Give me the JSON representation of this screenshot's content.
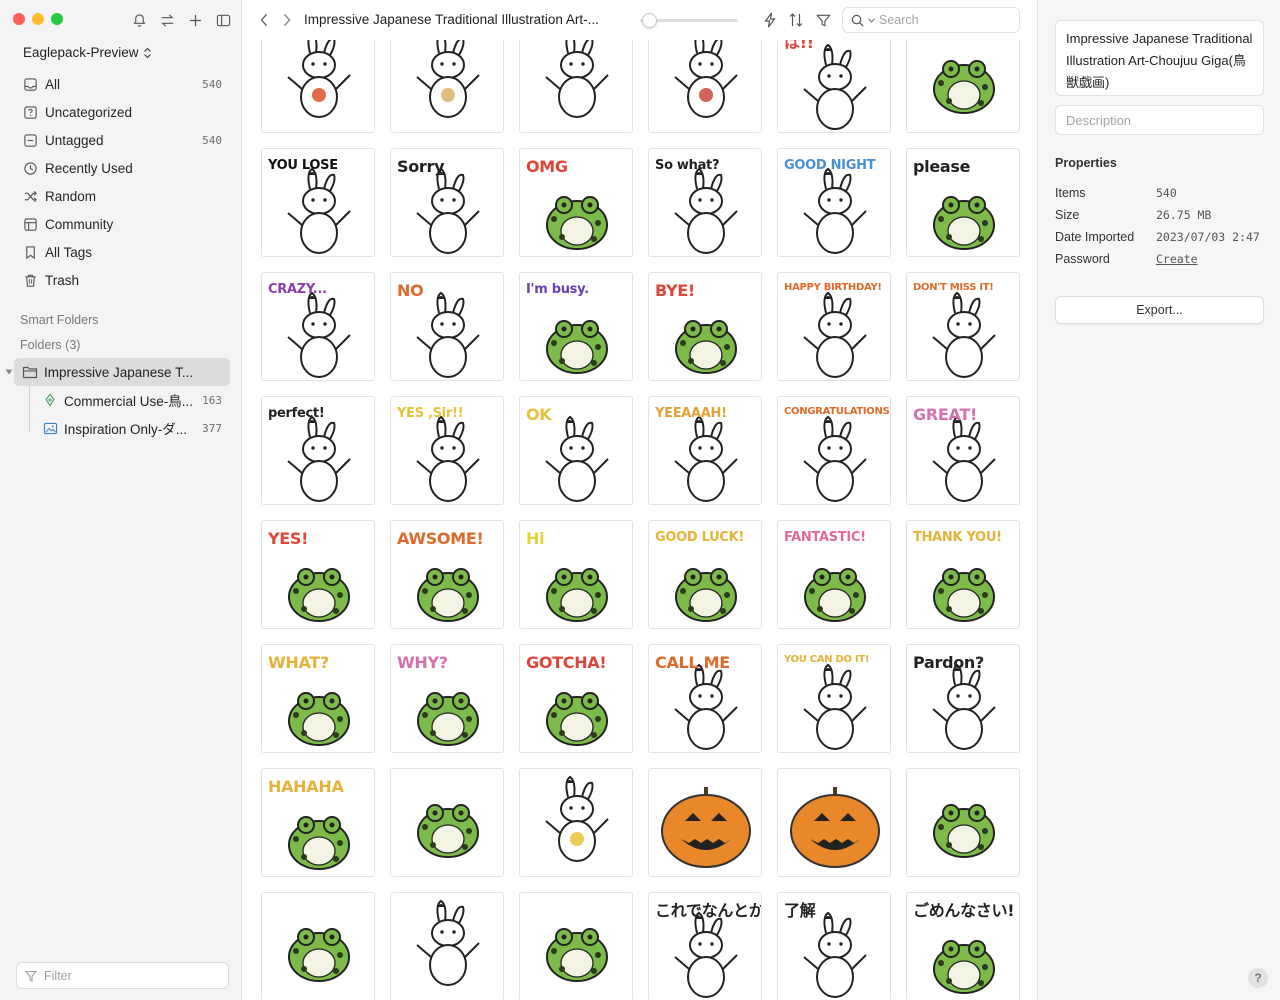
{
  "sidebar": {
    "library_name": "Eaglepack-Preview",
    "items": [
      {
        "label": "All",
        "count": "540",
        "icon": "inbox-icon"
      },
      {
        "label": "Uncategorized",
        "count": "",
        "icon": "question-box-icon"
      },
      {
        "label": "Untagged",
        "count": "540",
        "icon": "untagged-icon"
      },
      {
        "label": "Recently Used",
        "count": "",
        "icon": "clock-icon"
      },
      {
        "label": "Random",
        "count": "",
        "icon": "shuffle-icon"
      },
      {
        "label": "Community",
        "count": "",
        "icon": "community-icon"
      },
      {
        "label": "All Tags",
        "count": "",
        "icon": "bookmark-icon"
      },
      {
        "label": "Trash",
        "count": "",
        "icon": "trash-icon"
      }
    ],
    "smart_folders_label": "Smart Folders",
    "folders_label": "Folders (3)",
    "folder": {
      "label": "Impressive Japanese T...",
      "icon": "folder-icon"
    },
    "subfolders": [
      {
        "label": "Commercial Use-鳥...",
        "count": "163",
        "icon": "pen-nib-icon"
      },
      {
        "label": "Inspiration Only-ダ...",
        "count": "377",
        "icon": "image-icon"
      }
    ],
    "filter_placeholder": "Filter"
  },
  "toolbar": {
    "title": "Impressive Japanese Traditional Illustration Art-...",
    "search_placeholder": "Search",
    "zoom_level": 0.03
  },
  "grid": {
    "items": [
      {
        "caption": "",
        "kind": "bird-hood",
        "color": "#d9542b"
      },
      {
        "caption": "",
        "kind": "fox-standing",
        "color": "#d9b06a"
      },
      {
        "caption": "",
        "kind": "rabbit-ink",
        "color": "#222222"
      },
      {
        "caption": "",
        "kind": "monkey-red-hat",
        "color": "#c9483a"
      },
      {
        "caption": "は!!",
        "kind": "rabbit-shout",
        "color": "#e0453a"
      },
      {
        "caption": "",
        "kind": "frog-fart",
        "color": "#7cba4a"
      },
      {
        "caption": "YOU LOSE",
        "kind": "rabbit-point",
        "color": "#111111"
      },
      {
        "caption": "Sorry",
        "kind": "rabbit-sorry",
        "color": "#222222"
      },
      {
        "caption": "OMG",
        "kind": "frog-omg",
        "color": "#e0453a"
      },
      {
        "caption": "So what?",
        "kind": "rabbit-sowhat",
        "color": "#222222"
      },
      {
        "caption": "GOOD NIGHT",
        "kind": "rabbit-sleep",
        "color": "#4a8fd1"
      },
      {
        "caption": "please",
        "kind": "frog-please",
        "color": "#222222"
      },
      {
        "caption": "CRAZY...",
        "kind": "rabbit-crazy",
        "color": "#8a3fb0"
      },
      {
        "caption": "NO",
        "kind": "rabbit-lying",
        "color": "#e06a2a"
      },
      {
        "caption": "I'm busy.",
        "kind": "frog-phone",
        "color": "#6a3fb5"
      },
      {
        "caption": "BYE!",
        "kind": "frog-wave",
        "color": "#e0453a"
      },
      {
        "caption": "HAPPY BIRTHDAY!",
        "kind": "party-pair",
        "color": "#e06a2a"
      },
      {
        "caption": "DON'T MISS IT!",
        "kind": "rabbit-thumb",
        "color": "#e06a2a"
      },
      {
        "caption": "perfect!",
        "kind": "rabbit-perfect",
        "color": "#222222"
      },
      {
        "caption": "YES ,Sir!!",
        "kind": "salute-pair",
        "color": "#e6c33a"
      },
      {
        "caption": "OK",
        "kind": "rabbit-ok",
        "color": "#e6c33a"
      },
      {
        "caption": "YEEAAAH!",
        "kind": "rabbit-jump",
        "color": "#e6a23a"
      },
      {
        "caption": "CONGRATULATIONS!",
        "kind": "party-cheer",
        "color": "#e06a2a"
      },
      {
        "caption": "GREAT!",
        "kind": "rabbit-great",
        "color": "#d472b0"
      },
      {
        "caption": "YES!",
        "kind": "frog-yes",
        "color": "#e0453a"
      },
      {
        "caption": "AWSOME!",
        "kind": "frog-awsome",
        "color": "#e06a2a"
      },
      {
        "caption": "Hi",
        "kind": "frog-hi",
        "color": "#e6d23a"
      },
      {
        "caption": "GOOD LUCK!",
        "kind": "frog-luck",
        "color": "#e6b33a"
      },
      {
        "caption": "FANTASTIC!",
        "kind": "frog-fantastic",
        "color": "#e06a9a"
      },
      {
        "caption": "THANK YOU!",
        "kind": "frog-thanks",
        "color": "#e6b33a"
      },
      {
        "caption": "WHAT?",
        "kind": "frog-what",
        "color": "#e6b33a"
      },
      {
        "caption": "WHY?",
        "kind": "frog-why",
        "color": "#d472b0"
      },
      {
        "caption": "GOTCHA!",
        "kind": "frog-gotcha",
        "color": "#e0453a"
      },
      {
        "caption": "CALL ME",
        "kind": "rabbit-callme",
        "color": "#e06a2a"
      },
      {
        "caption": "YOU CAN DO IT!",
        "kind": "rabbit-doit",
        "color": "#e6b33a"
      },
      {
        "caption": "Pardon?",
        "kind": "rabbit-pardon",
        "color": "#222222"
      },
      {
        "caption": "HAHAHA",
        "kind": "frog-laugh",
        "color": "#e6b33a"
      },
      {
        "caption": "",
        "kind": "frog-swim",
        "color": "#7cba4a"
      },
      {
        "caption": "",
        "kind": "rabbit-drink",
        "color": "#e6c33a"
      },
      {
        "caption": "",
        "kind": "pumpkin",
        "color": "#e8882a"
      },
      {
        "caption": "",
        "kind": "pumpkin-rabbit",
        "color": "#e8882a"
      },
      {
        "caption": "",
        "kind": "frog-witch",
        "color": "#5a5a6a"
      },
      {
        "caption": "",
        "kind": "frog-spider",
        "color": "#e6a23a"
      },
      {
        "caption": "",
        "kind": "mummy-rabbit",
        "color": "#222222"
      },
      {
        "caption": "",
        "kind": "frog-pumpkin-head",
        "color": "#e8882a"
      },
      {
        "caption": "これでなんとか",
        "kind": "rabbit-carrot",
        "color": "#222222"
      },
      {
        "caption": "了解",
        "kind": "rabbit-salute",
        "color": "#222222"
      },
      {
        "caption": "ごめんなさい!",
        "kind": "frog-sorry",
        "color": "#222222"
      }
    ]
  },
  "inspector": {
    "name": "Impressive Japanese Traditional Illustration Art-Choujuu Giga(鳥獣戯画)",
    "description_placeholder": "Description",
    "properties_title": "Properties",
    "properties": [
      {
        "key": "Items",
        "value": "540"
      },
      {
        "key": "Size",
        "value": "26.75 MB"
      },
      {
        "key": "Date Imported",
        "value": "2023/07/03 2:47"
      },
      {
        "key": "Password",
        "value": "Create"
      }
    ],
    "export_label": "Export...",
    "help_label": "?"
  },
  "colors": {
    "frog_green": "#7cba4a",
    "sidebar_bg": "#f4f4f4",
    "selected_bg": "#dcdcdc"
  }
}
